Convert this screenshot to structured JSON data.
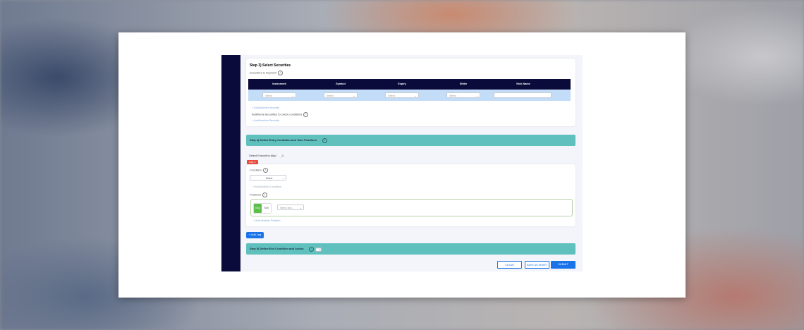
{
  "step3": {
    "title": "Step 3) Select Securities",
    "securities_label": "Securities to Buy/Sell",
    "columns": [
      "Instrument",
      "Symbol",
      "Expiry",
      "Strike",
      "Nick Name"
    ],
    "row_placeholders": [
      "Select",
      "Select",
      "Select",
      "Select",
      ""
    ],
    "add_security": "+ Add Another Security",
    "additional_label": "Additional Securities to check conditions",
    "add_security_2": "+ Add Another Security"
  },
  "step4": {
    "title": "Step 4) Define Entry Condition and Take Positions",
    "algo_label": "Select Execution Algo",
    "leg_tag": "Leg 1",
    "condition_label": "Condition",
    "condition_select": "Select",
    "add_condition": "+ Add Another Condition",
    "positions_label": "Positions",
    "buy_label": "Buy",
    "sell_label": "Sell",
    "security_select": "Select Sec...",
    "add_position": "+ Add Another Position",
    "add_leg": "+ Add Leg"
  },
  "step5": {
    "title": "Step 5) Define Exit Condition and Action"
  },
  "footer": {
    "clear": "CLEAR",
    "save_draft": "SAVE AS DRAFT",
    "submit": "SUBMIT"
  },
  "colors": {
    "sidebar": "#0b0b3b",
    "step_bar": "#5fc0bd",
    "leg_tag": "#e74c3c",
    "buy": "#5bbf4a",
    "primary": "#1a73e8"
  }
}
